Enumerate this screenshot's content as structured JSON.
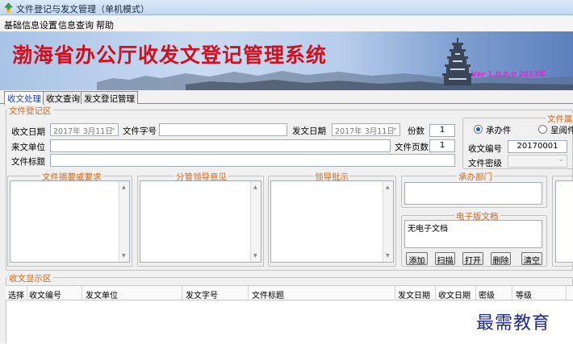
{
  "window": {
    "title": "文件登记与发文管理（单机模式）"
  },
  "menu": {
    "items": [
      "基础信息设置",
      "信息查询",
      "帮助"
    ]
  },
  "banner": {
    "title": "渤海省办公厅收发文登记管理系统",
    "version": "Ver 1.0.0.0  2017年"
  },
  "tabs": [
    {
      "label": "收文处理",
      "active": true
    },
    {
      "label": "收文查询",
      "active": false
    },
    {
      "label": "发文登记管理",
      "active": false
    }
  ],
  "register": {
    "group_title": "文件登记区",
    "receive_date_label": "收文日期",
    "receive_date_value": "2017年 3月11日",
    "doc_number_label": "文件字号",
    "doc_number_value": "",
    "send_date_label": "发文日期",
    "send_date_value": "2017年 3月11日",
    "copies_label": "份数",
    "copies_value": "1",
    "sender_label": "来文单位",
    "sender_value": "",
    "pages_label": "文件页数",
    "pages_value": "1",
    "doc_title_label": "文件标题",
    "doc_title_value": ""
  },
  "file_attr": {
    "group_title": "文件属",
    "radio_handle": "承办件",
    "radio_read": "呈阅件",
    "receive_no_label": "收文编号",
    "receive_no_value": "20170001",
    "secret_label": "文件密级",
    "secret_value": ""
  },
  "panels": {
    "summary_title": "文件摘要或要求",
    "leader_opinion_title": "分管领导意见",
    "leader_instruction_title": "领导批示",
    "dept_title": "承办部门"
  },
  "edoc": {
    "group_title": "电子版文档",
    "status": "无电子文档",
    "buttons": [
      "添加",
      "扫描",
      "打开",
      "删除",
      "清空"
    ]
  },
  "display": {
    "group_title": "收文显示区",
    "columns": [
      "选择",
      "收文编号",
      "发文单位",
      "发文字号",
      "文件标题",
      "发文日期",
      "收文日期",
      "密级",
      "等级"
    ]
  },
  "watermark": "最需教育",
  "colors": {
    "banner_title": "#d0101e",
    "group_title": "#d2691e",
    "active_tab": "#1a3fc7"
  }
}
